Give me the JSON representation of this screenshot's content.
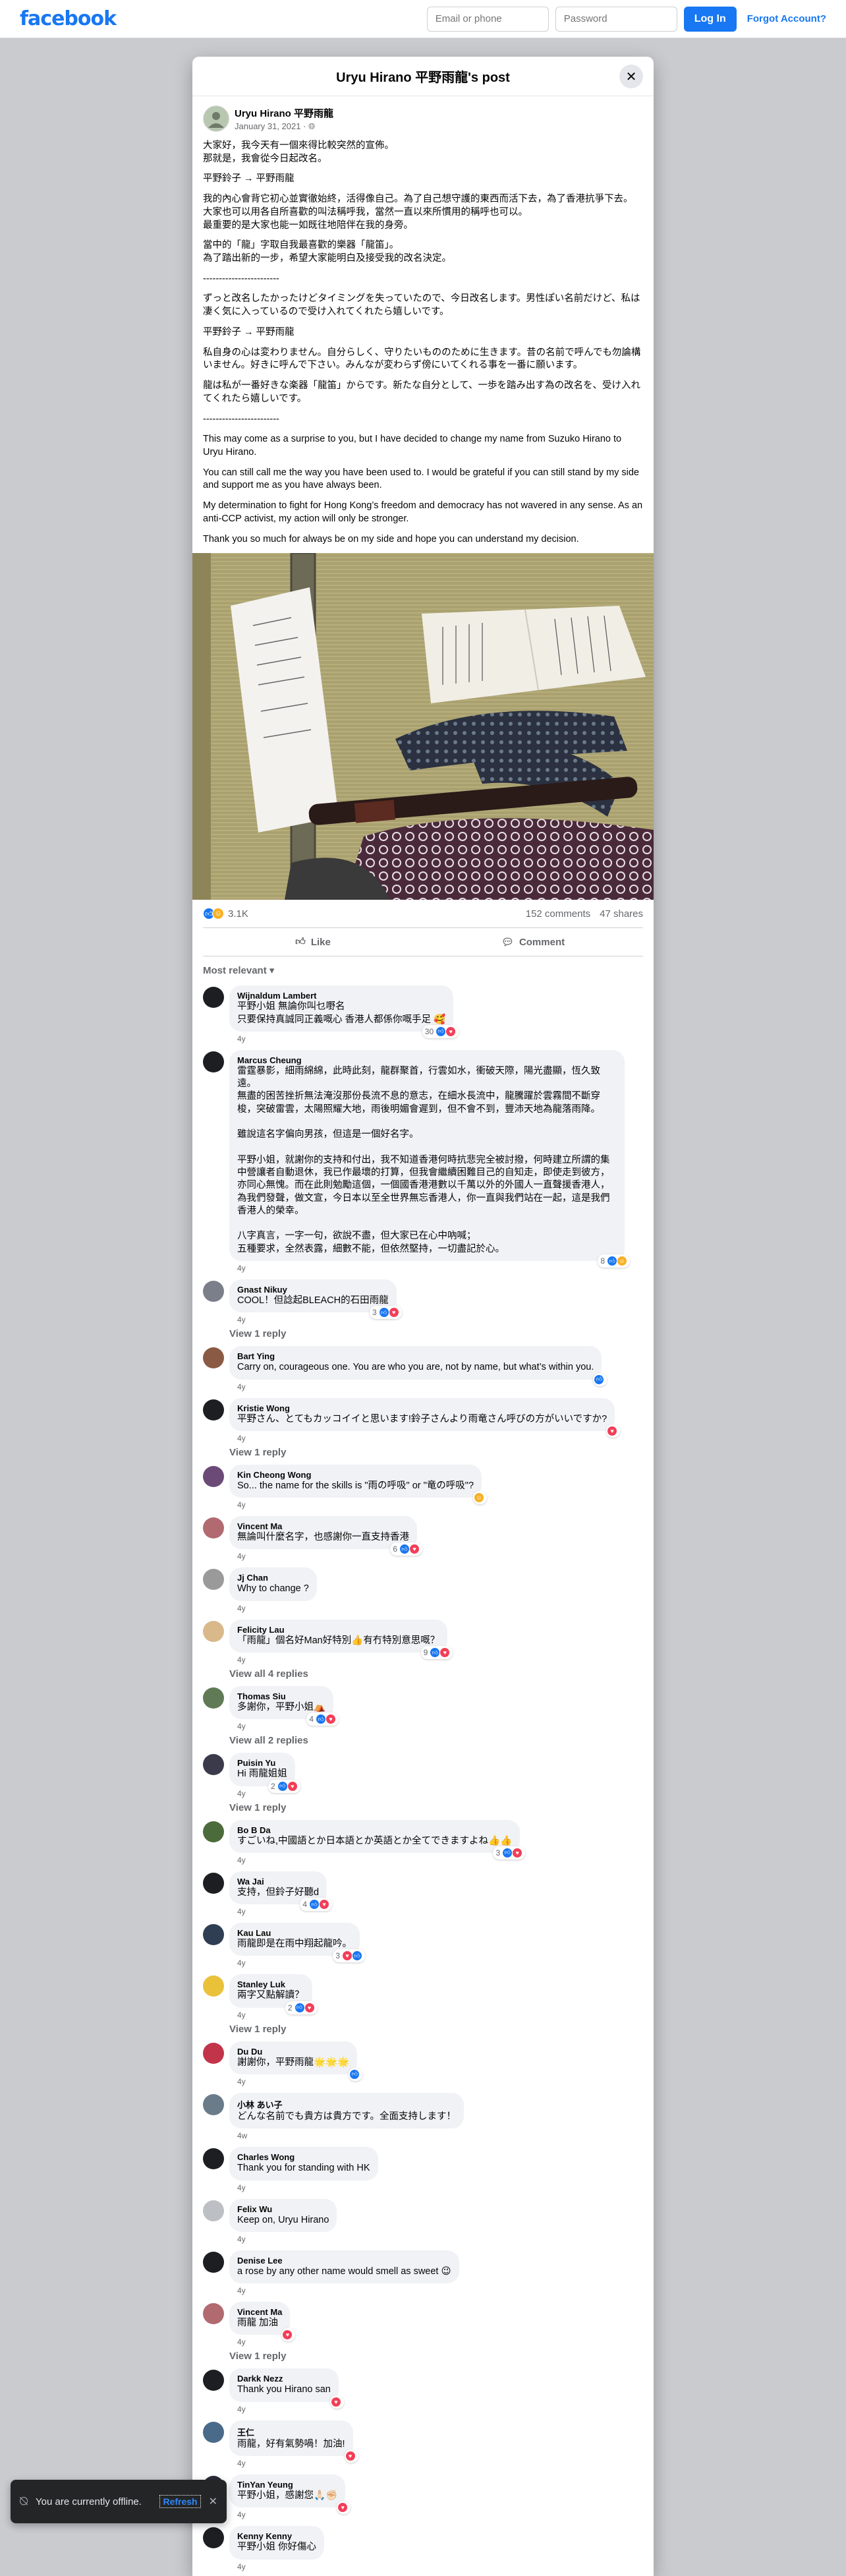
{
  "topbar": {
    "logo": "facebook",
    "email_placeholder": "Email or phone",
    "password_placeholder": "Password",
    "login_label": "Log In",
    "forgot_label": "Forgot Account?"
  },
  "modal": {
    "title": "Uryu Hirano 平野雨龍's post",
    "close_icon": "close-icon"
  },
  "post": {
    "author": "Uryu Hirano 平野雨龍",
    "date": "January 31, 2021",
    "audience_icon": "globe-icon",
    "paragraphs": [
      "大家好，我今天有一個來得比較突然的宣佈。\n那就是，我會從今日起改名。",
      "平野鈴子 → 平野雨龍",
      "我的內心會背它初心並實徹始終，活得像自己。為了自己想守護的東西而活下去，為了香港抗爭下去。\n大家也可以用各自所喜歡的叫法稱呼我，當然一直以來所慣用的稱呼也可以。\n最重要的是大家也能一如既往地陪伴在我的身旁。",
      "當中的「龍」字取自我最喜歡的樂器「龍笛」。\n為了踏出新的一步，希望大家能明白及接受我的改名決定。",
      "------------------------",
      "ずっと改名したかったけどタイミングを失っていたので、今日改名します。男性ぽい名前だけど、私は凄く気に入っているので受け入れてくれたら嬉しいです。",
      "平野鈴子 → 平野雨龍",
      "私自身の心は変わりません。自分らしく、守りたいもののために生きます。昔の名前で呼んでも勿論構いません。好きに呼んで下さい。みんなが変わらず傍にいてくれる事を一番に願います。",
      "龍は私が一番好きな楽器「龍笛」からです。新たな自分として、一歩を踏み出す為の改名を、受け入れてくれたら嬉しいです。",
      "------------------------",
      "This may come as a surprise to you, but I have decided to change my name from Suzuko Hirano to Uryu Hirano.",
      "You can still call me the way you have been used to. I would be grateful if you can still stand by my side and support me as you have always been.",
      "My determination to fight for Hong Kong’s freedom and democracy has not wavered in any sense. As an anti-CCP activist, my action will only be stronger.",
      "Thank you so much for always be on my side and hope you can understand my decision."
    ],
    "reaction_count": "3.1K",
    "comment_count": "152 comments",
    "share_count": "47 shares",
    "like_label": "Like",
    "comment_label": "Comment",
    "sort_label": "Most relevant"
  },
  "colors": {
    "brand": "#1877f2",
    "like": "#1877f2",
    "love": "#f33e58",
    "care": "#f7b125"
  },
  "comments": [
    {
      "name": "Wijnaldum Lambert",
      "text": "平野小姐 無論你叫乜嘢名\n只要保持真誠同正義嘅心 香港人都係你嘅手足 🥰",
      "time": "4y",
      "reacts": "30",
      "types": [
        "like",
        "love"
      ],
      "replies": "",
      "color": "#1c1e21"
    },
    {
      "name": "Marcus Cheung",
      "text": "雷霆暴影，細雨綿綿，此時此刻，龍群聚首，行雲如水，衝破天際，陽光盡顯，恆久致遠。\n無盡的困苦挫折無法淹沒那份長流不息的意志，在細水長流中，龍騰躍於雲霧間不斷穿梭，突破雷雲，太陽照耀大地，雨後明媚會遲到，但不會不到，豐沛天地為龍落雨降。\n\n雖說這名字偏向男孩，但這是一個好名字。\n\n平野小姐，就謝你的支持和付出，我不知道香港何時抗悲完全被討撥，何時建立所謂的集中營讓者自動退休，我已作最壞的打算，但我會繼續困難目己的自知走，即使走到彼方，亦同心無愧。而在此則勉勵這個，一個國香港港數以千萬以外的外國人一直聲援香港人，為我們發聲，做文宣，今日本以至全世界無忘香港人，你一直與我們站在一起，這是我們香港人的榮幸。\n\n八字真言，一字一句，欲說不盡，但大家已在心中吶喊；\n五種要求，全然表露，細數不能，但依然堅持，一切盡記於心。",
      "time": "4y",
      "reacts": "8",
      "types": [
        "like",
        "care"
      ],
      "replies": "",
      "color": "#1c1e21"
    },
    {
      "name": "Gnast Nikuy",
      "text": "COOL！但諗起BLEACH的石田雨龍",
      "time": "4y",
      "reacts": "3",
      "types": [
        "like",
        "love"
      ],
      "replies": "View 1 reply",
      "color": "#7a7f8a"
    },
    {
      "name": "Bart Ying",
      "text": "Carry on, courageous one. You are who you are, not by name, but what’s within you.",
      "time": "4y",
      "reacts": "",
      "types": [
        "like"
      ],
      "replies": "",
      "color": "#8a5a44"
    },
    {
      "name": "Kristie Wong",
      "text": "平野さん、とてもカッコイイと思います!鈴子さんより雨竜さん呼びの方がいいですか?",
      "time": "4y",
      "reacts": "",
      "types": [
        "love"
      ],
      "replies": "View 1 reply",
      "color": "#1c1e21"
    },
    {
      "name": "Kin Cheong Wong",
      "text": "So... the name for the skills is \"雨の呼吸\" or \"竜の呼吸\"?",
      "time": "4y",
      "reacts": "",
      "types": [
        "care"
      ],
      "replies": "",
      "color": "#6b4a78"
    },
    {
      "name": "Vincent Ma",
      "text": "無論叫什麼名字，也感謝你一直支持香港",
      "time": "4y",
      "reacts": "6",
      "types": [
        "like",
        "love"
      ],
      "replies": "",
      "color": "#b06a70"
    },
    {
      "name": "Jj Chan",
      "text": "Why to change ?",
      "time": "4y",
      "reacts": "",
      "types": [],
      "replies": "",
      "color": "#9a9a9a"
    },
    {
      "name": "Felicity Lau",
      "text": "「雨龍」個名好Man好特別👍有冇特別意思嘅？",
      "time": "4y",
      "reacts": "9",
      "types": [
        "like",
        "love"
      ],
      "replies": "View all 4 replies",
      "color": "#d9b98a"
    },
    {
      "name": "Thomas Siu",
      "text": "多謝你，平野小姐⛺",
      "time": "4y",
      "reacts": "4",
      "types": [
        "like",
        "love"
      ],
      "replies": "View all 2 replies",
      "color": "#5f7a55"
    },
    {
      "name": "Puisin Yu",
      "text": "Hi 雨龍姐姐",
      "time": "4y",
      "reacts": "2",
      "types": [
        "like",
        "love"
      ],
      "replies": "View 1 reply",
      "color": "#3a3a4a"
    },
    {
      "name": "Bo B Da",
      "text": "すごいね,中國語とか日本語とか英語とか全てできますよね👍👍",
      "time": "4y",
      "reacts": "3",
      "types": [
        "like",
        "love"
      ],
      "replies": "",
      "color": "#4c6b3a"
    },
    {
      "name": "Wa Jai",
      "text": "支持，但鈴子好聽d",
      "time": "4y",
      "reacts": "4",
      "types": [
        "like",
        "love"
      ],
      "replies": "",
      "color": "#1c1e21"
    },
    {
      "name": "Kau Lau",
      "text": "雨龍即是在雨中翔起龍吟。",
      "time": "4y",
      "reacts": "3",
      "types": [
        "love",
        "like"
      ],
      "replies": "",
      "color": "#2f3e52"
    },
    {
      "name": "Stanley Luk",
      "text": "兩字又點解讀？",
      "time": "4y",
      "reacts": "2",
      "types": [
        "like",
        "love"
      ],
      "replies": "View 1 reply",
      "color": "#e9c23a"
    },
    {
      "name": "Du Du",
      "text": "謝謝你，平野雨龍🌟🌟🌟",
      "time": "4y",
      "reacts": "",
      "types": [
        "like"
      ],
      "replies": "",
      "color": "#c2344a"
    },
    {
      "name": "小林 あい子",
      "text": "どんな名前でも貴方は貴方です。全面支持します！",
      "time": "4w",
      "reacts": "",
      "types": [],
      "replies": "",
      "color": "#6a7b8a"
    },
    {
      "name": "Charles Wong",
      "text": "Thank you for standing with HK",
      "time": "4y",
      "reacts": "",
      "types": [],
      "replies": "",
      "color": "#1c1e21"
    },
    {
      "name": "Felix Wu",
      "text": "Keep on, Uryu Hirano",
      "time": "4y",
      "reacts": "",
      "types": [],
      "replies": "",
      "color": "#bcc0c4"
    },
    {
      "name": "Denise Lee",
      "text": "a rose by any other name would smell as sweet 😉",
      "time": "4y",
      "reacts": "",
      "types": [],
      "replies": "",
      "color": "#1c1e21"
    },
    {
      "name": "Vincent Ma",
      "text": "雨龍 加油",
      "time": "4y",
      "reacts": "",
      "types": [
        "love"
      ],
      "replies": "View 1 reply",
      "color": "#b06a70"
    },
    {
      "name": "Darkk Nezz",
      "text": "Thank you Hirano san",
      "time": "4y",
      "reacts": "",
      "types": [
        "love"
      ],
      "replies": "",
      "color": "#1c1e21"
    },
    {
      "name": "王仁",
      "text": "雨龍，好有氣勢喎！加油!",
      "time": "4y",
      "reacts": "",
      "types": [
        "love"
      ],
      "replies": "",
      "color": "#4a6a8a"
    },
    {
      "name": "TinYan Yeung",
      "text": "平野小姐，感謝您🙏🏻✊🏻",
      "time": "4y",
      "reacts": "",
      "types": [
        "love"
      ],
      "replies": "",
      "color": "#2b2b3a"
    },
    {
      "name": "Kenny Kenny",
      "text": "平野小姐 你好傷心",
      "time": "4y",
      "reacts": "",
      "types": [],
      "replies": "",
      "color": "#1c1e21"
    }
  ],
  "toast": {
    "message": "You are currently offline.",
    "refresh_label": "Refresh",
    "icon": "wifi-off-icon"
  }
}
